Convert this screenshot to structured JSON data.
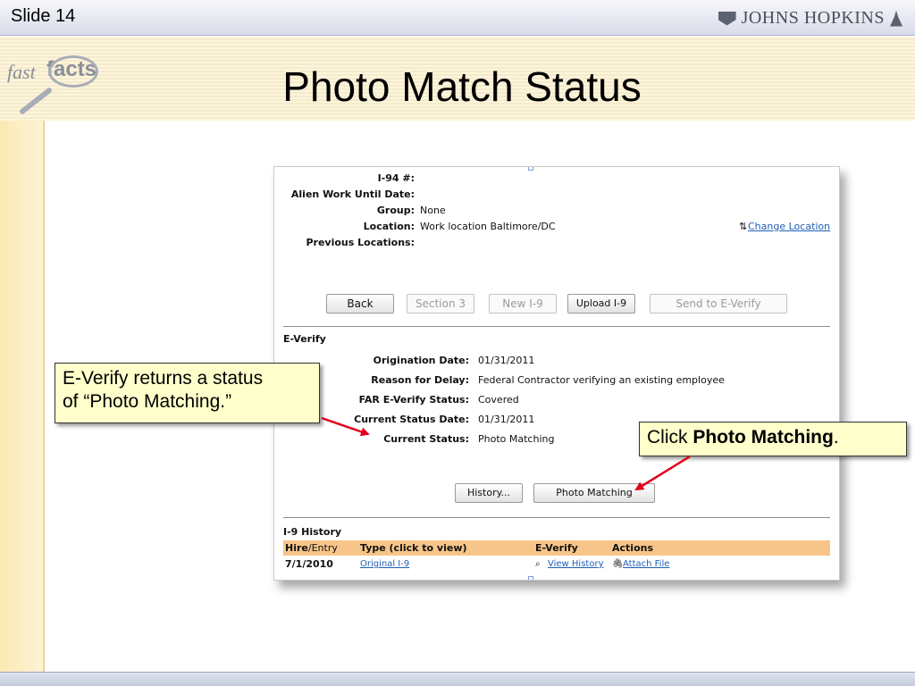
{
  "slide": {
    "number_label": "Slide 14",
    "logo_text": "JOHNS HOPKINS",
    "fastfacts_fast": "fast",
    "fastfacts_facts": "facts",
    "title": "Photo Match Status"
  },
  "screenshot": {
    "fields_top": [
      {
        "label": "I-94 #:",
        "value": ""
      },
      {
        "label": "Alien Work Until Date:",
        "value": ""
      },
      {
        "label": "Group:",
        "value": "None"
      },
      {
        "label": "Location:",
        "value": "Work location Baltimore/DC"
      },
      {
        "label": "Previous Locations:",
        "value": ""
      }
    ],
    "change_location_icon": "⇅",
    "change_location_link": "Change Location",
    "buttons": {
      "back": "Back",
      "section3": "Section 3",
      "new_i9": "New I-9",
      "upload_i9": "Upload I-9",
      "send_to_everify": "Send to E-Verify",
      "history": "History...",
      "photo_matching": "Photo Matching"
    },
    "everify_section_title": "E-Verify",
    "everify_fields": [
      {
        "label": "Origination Date:",
        "value": "01/31/2011"
      },
      {
        "label": "Reason for Delay:",
        "value": "Federal Contractor verifying an existing employee"
      },
      {
        "label": "FAR E-Verify Status:",
        "value": "Covered"
      },
      {
        "label": "Current Status Date:",
        "value": "01/31/2011"
      },
      {
        "label": "Current Status:",
        "value": "Photo Matching"
      }
    ],
    "history_section_title": "I-9 History",
    "history_columns": {
      "hire_bold": "Hire",
      "hire_rest": "/Entry",
      "type": "Type (click to view)",
      "everify": "E-Verify",
      "actions": "Actions"
    },
    "history_rows": [
      {
        "date": "7/1/2010",
        "type": "Original I-9",
        "everify": "View History",
        "actions": "Attach File"
      }
    ]
  },
  "callouts": {
    "left_line1": "E-Verify returns a status",
    "left_line2": "of “Photo Matching.”",
    "right_prefix": "Click ",
    "right_bold": "Photo Matching",
    "right_suffix": "."
  },
  "colors": {
    "arrow": "#e0001b",
    "callout_bg": "#ffffcc",
    "history_header": "#f7c58a",
    "link": "#1f5fb5"
  }
}
